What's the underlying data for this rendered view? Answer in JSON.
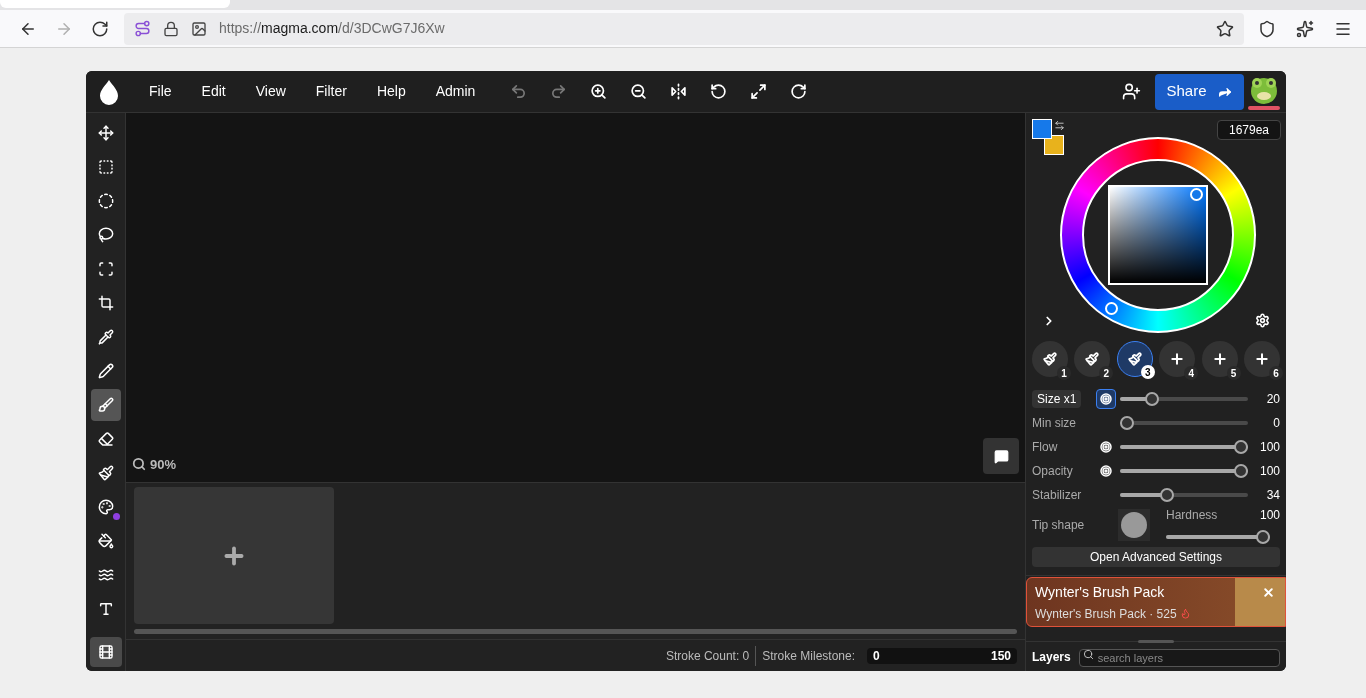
{
  "browser": {
    "nav": [
      {
        "kind": "back",
        "disabled": false
      },
      {
        "kind": "forward",
        "disabled": true
      },
      {
        "kind": "reload",
        "disabled": false
      }
    ],
    "url": "https://**magma.com**/d/3DCwG7J6Xw"
  },
  "menu": [
    "File",
    "Edit",
    "View",
    "Filter",
    "Help",
    "Admin"
  ],
  "toolbar": [
    {
      "kind": "undo",
      "disabled": true
    },
    {
      "kind": "redo",
      "disabled": true
    },
    {
      "kind": "zoom-in",
      "disabled": false
    },
    {
      "kind": "zoom-out",
      "disabled": false
    },
    {
      "kind": "flip",
      "disabled": false
    },
    {
      "kind": "rotate-left",
      "disabled": false
    },
    {
      "kind": "fullscreen",
      "disabled": false
    },
    {
      "kind": "rotate-right",
      "disabled": false
    }
  ],
  "share_button": {
    "label": "Share"
  },
  "tools": [
    {
      "kind": "move",
      "selected": false,
      "badge": false
    },
    {
      "kind": "rect-select",
      "selected": false,
      "badge": false
    },
    {
      "kind": "ellipse-select",
      "selected": false,
      "badge": false
    },
    {
      "kind": "lasso",
      "selected": false,
      "badge": false
    },
    {
      "kind": "transform",
      "selected": false,
      "badge": false
    },
    {
      "kind": "crop",
      "selected": false,
      "badge": false
    },
    {
      "kind": "eyedropper",
      "selected": false,
      "badge": false
    },
    {
      "kind": "pencil",
      "selected": false,
      "badge": false
    },
    {
      "kind": "brush",
      "selected": true,
      "badge": false
    },
    {
      "kind": "eraser",
      "selected": false,
      "badge": false
    },
    {
      "kind": "blend",
      "selected": false,
      "badge": false
    },
    {
      "kind": "palette",
      "selected": false,
      "badge": true
    },
    {
      "kind": "fill",
      "selected": false,
      "badge": false
    },
    {
      "kind": "smudge",
      "selected": false,
      "badge": false
    },
    {
      "kind": "text",
      "selected": false,
      "badge": false
    }
  ],
  "timeline_toggle": {
    "on": true
  },
  "canvas": {
    "zoom": "90%"
  },
  "status_bar": {
    "stroke_count": "Stroke Count: 0",
    "milestone_label": "Stroke Milestone:",
    "milestone_start": "0",
    "milestone_end": "150",
    "level": 0
  },
  "color": {
    "swatches": [
      {
        "color": "#1679ea"
      },
      {
        "color": "#e8b21c"
      }
    ],
    "hex": "1679ea"
  },
  "brush_slots": [
    {
      "kind": "brush",
      "number": "1",
      "selected": false
    },
    {
      "kind": "brush",
      "number": "2",
      "selected": false
    },
    {
      "kind": "brush",
      "number": "3",
      "selected": true
    },
    {
      "kind": "empty",
      "number": "4",
      "selected": false
    },
    {
      "kind": "empty",
      "number": "5",
      "selected": false
    },
    {
      "kind": "empty",
      "number": "6",
      "selected": false
    }
  ],
  "sliders": [
    {
      "label": "Size x1",
      "kind": "chip",
      "pressure": true,
      "level": 0.22,
      "reading": "20"
    },
    {
      "label": "Min size",
      "kind": "plain",
      "level": 0,
      "reading": "0"
    },
    {
      "label": "Flow",
      "kind": "plain",
      "pressure": false,
      "level": 1,
      "reading": "100"
    },
    {
      "label": "Opacity",
      "kind": "plain",
      "pressure": false,
      "level": 1,
      "reading": "100"
    },
    {
      "label": "Stabilizer",
      "kind": "plain",
      "level": 0.35,
      "reading": "34"
    }
  ],
  "tip": {
    "label": "Tip shape",
    "hardness_label": "Hardness",
    "hardness_reading": "100",
    "level": 1
  },
  "advanced_button": "Open Advanced Settings",
  "promo": {
    "title": "Wynter's Brush Pack",
    "subtitle": "Wynter's Brush Pack · 525"
  },
  "layers": {
    "label": "Layers",
    "placeholder": "search layers"
  }
}
